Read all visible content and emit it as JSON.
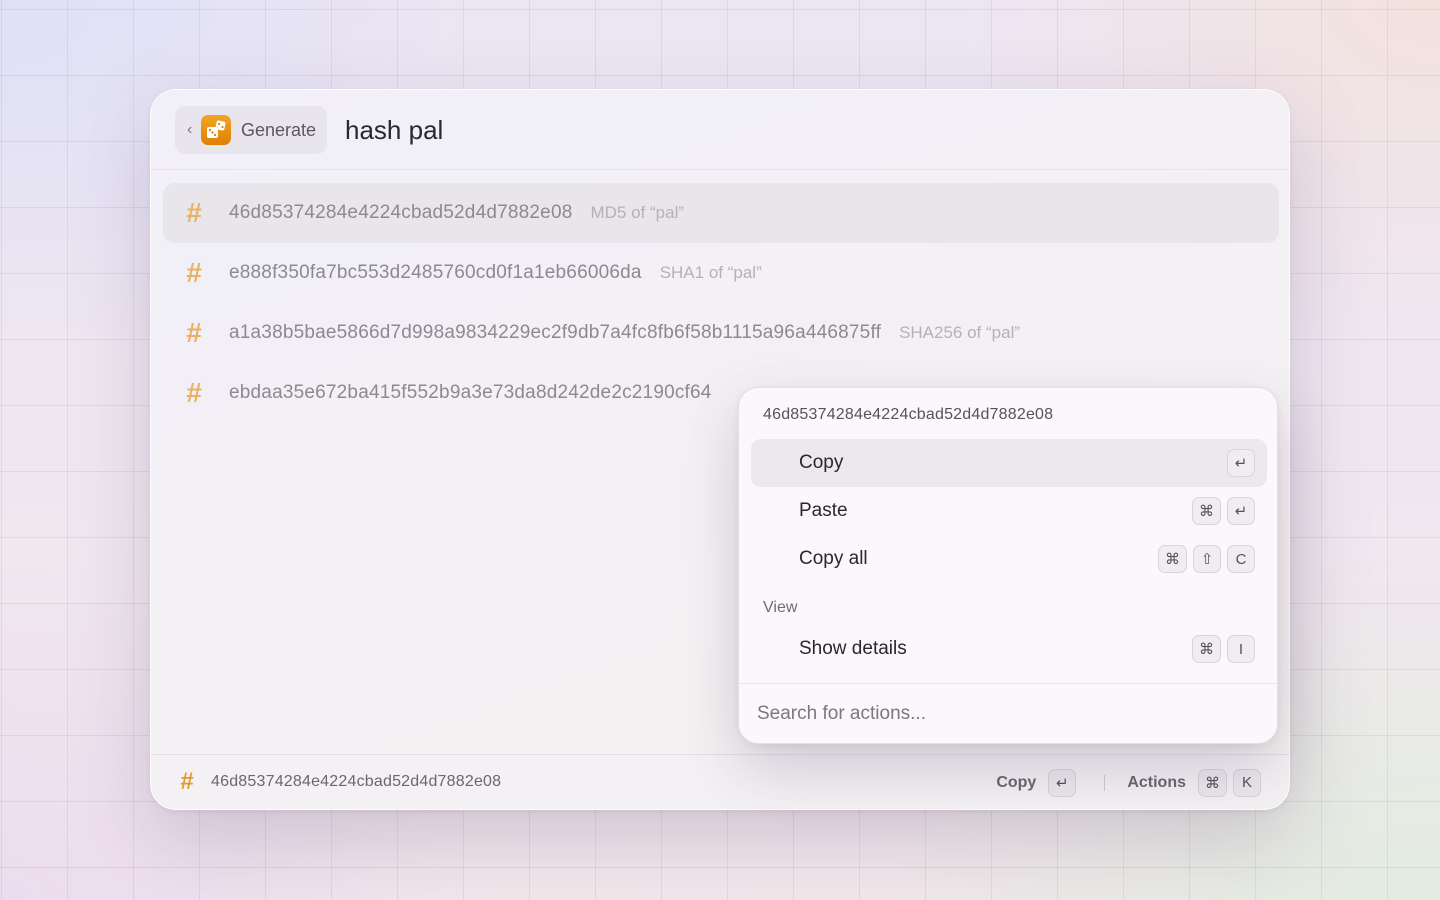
{
  "header": {
    "back_label": "Generate",
    "back_chevron": "‹",
    "app_icon": "dice-icon",
    "query": "hash pal"
  },
  "results": [
    {
      "icon": "#",
      "title": "46d85374284e4224cbad52d4d7882e08",
      "subtitle": "MD5 of “pal”",
      "selected": true
    },
    {
      "icon": "#",
      "title": "e888f350fa7bc553d2485760cd0f1a1eb66006da",
      "subtitle": "SHA1 of “pal”",
      "selected": false
    },
    {
      "icon": "#",
      "title": "a1a38b5bae5866d7d998a9834229ec2f9db7a4fc8fb6f58b1115a96a446875ff",
      "subtitle": "SHA256 of “pal”",
      "selected": false
    },
    {
      "icon": "#",
      "title": "ebdaa35e672ba415f552b9a3e73da8d242de2c2190cf64",
      "subtitle": "",
      "selected": false
    }
  ],
  "actions_panel": {
    "header": "46d85374284e4224cbad52d4d7882e08",
    "items": [
      {
        "label": "Copy",
        "keys": [
          "↵"
        ],
        "active": true
      },
      {
        "label": "Paste",
        "keys": [
          "⌘",
          "↵"
        ],
        "active": false
      },
      {
        "label": "Copy all",
        "keys": [
          "⌘",
          "⇧",
          "C"
        ],
        "active": false
      }
    ],
    "section_view": "View",
    "view_items": [
      {
        "label": "Show details",
        "keys": [
          "⌘",
          "I"
        ]
      }
    ],
    "search_placeholder": "Search for actions..."
  },
  "footer": {
    "icon": "#",
    "title": "46d85374284e4224cbad52d4d7882e08",
    "primary_action_label": "Copy",
    "primary_action_key": "↵",
    "actions_label": "Actions",
    "actions_keys": [
      "⌘",
      "K"
    ]
  },
  "colors": {
    "accent": "#e39a2e",
    "hash_icon": "#eab163",
    "selected_row": "#e8e6ea"
  }
}
